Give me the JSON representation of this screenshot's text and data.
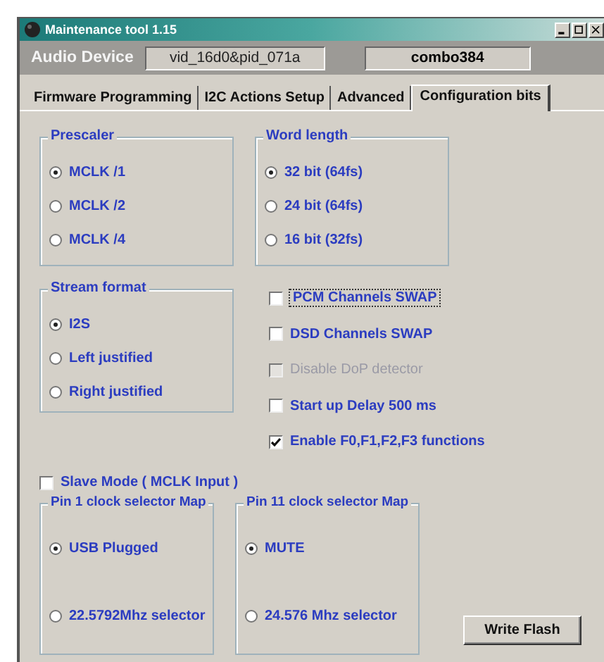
{
  "window": {
    "title": "Maintenance tool 1.15"
  },
  "device_bar": {
    "label": "Audio Device",
    "vid_pid": "vid_16d0&pid_071a",
    "device_name": "combo384"
  },
  "tabs": [
    {
      "label": "Firmware Programming",
      "selected": false
    },
    {
      "label": "I2C Actions Setup",
      "selected": false
    },
    {
      "label": "Advanced",
      "selected": false
    },
    {
      "label": "Configuration bits",
      "selected": true
    }
  ],
  "prescaler": {
    "title": "Prescaler",
    "options": [
      {
        "label": "MCLK /1",
        "selected": true
      },
      {
        "label": "MCLK /2",
        "selected": false
      },
      {
        "label": "MCLK /4",
        "selected": false
      }
    ]
  },
  "word_length": {
    "title": "Word length",
    "options": [
      {
        "label": "32 bit (64fs)",
        "selected": true
      },
      {
        "label": "24 bit (64fs)",
        "selected": false
      },
      {
        "label": "16 bit (32fs)",
        "selected": false
      }
    ]
  },
  "stream_format": {
    "title": "Stream format",
    "options": [
      {
        "label": "I2S",
        "selected": true
      },
      {
        "label": "Left justified",
        "selected": false
      },
      {
        "label": "Right justified",
        "selected": false
      }
    ]
  },
  "options": [
    {
      "label": "PCM Channels SWAP",
      "checked": false,
      "disabled": false,
      "focused": true
    },
    {
      "label": "DSD Channels SWAP",
      "checked": false,
      "disabled": false,
      "focused": false
    },
    {
      "label": "Disable DoP detector",
      "checked": false,
      "disabled": true,
      "focused": false
    },
    {
      "label": "Start up Delay 500 ms",
      "checked": false,
      "disabled": false,
      "focused": false
    },
    {
      "label": "Enable F0,F1,F2,F3 functions",
      "checked": true,
      "disabled": false,
      "focused": false
    }
  ],
  "slave_mode": {
    "label": "Slave Mode ( MCLK Input )",
    "checked": false
  },
  "pin1_map": {
    "title": "Pin 1 clock selector Map",
    "options": [
      {
        "label": "USB Plugged",
        "selected": true
      },
      {
        "label": "22.5792Mhz selector",
        "selected": false
      }
    ]
  },
  "pin11_map": {
    "title": "Pin 11 clock selector Map",
    "options": [
      {
        "label": "MUTE",
        "selected": true
      },
      {
        "label": "24.576 Mhz selector",
        "selected": false
      }
    ]
  },
  "write_button": {
    "label": "Write Flash"
  }
}
